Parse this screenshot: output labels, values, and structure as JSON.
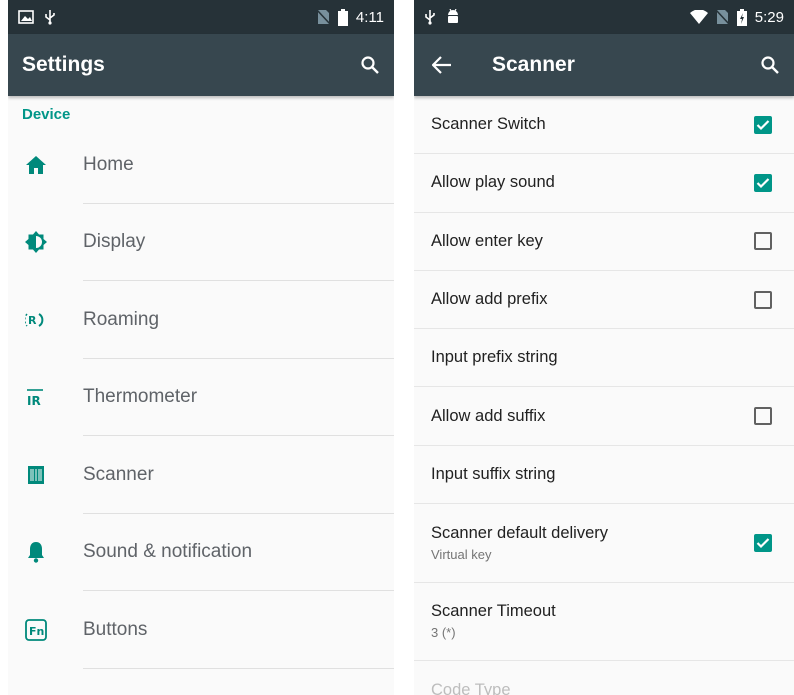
{
  "colors": {
    "accent": "#009688",
    "status_bar": "#263238",
    "toolbar": "#37474f"
  },
  "left_screen": {
    "status": {
      "left_icons": [
        "image-icon",
        "usb-icon"
      ],
      "right_icons": [
        "no-sim-icon",
        "battery-icon"
      ],
      "time": "4:11"
    },
    "toolbar": {
      "title": "Settings",
      "search_icon": "search-icon"
    },
    "section": "Device",
    "items": [
      {
        "label": "Home",
        "icon": "home-icon"
      },
      {
        "label": "Display",
        "icon": "brightness-icon"
      },
      {
        "label": "Roaming",
        "icon": "roaming-icon"
      },
      {
        "label": "Thermometer",
        "icon": "ir-icon",
        "icon_text": "IR"
      },
      {
        "label": "Scanner",
        "icon": "scanner-icon"
      },
      {
        "label": "Sound & notification",
        "icon": "bell-icon"
      },
      {
        "label": "Buttons",
        "icon": "fn-icon",
        "icon_text": "Fn"
      }
    ]
  },
  "right_screen": {
    "status": {
      "left_icons": [
        "usb-icon",
        "android-icon"
      ],
      "right_icons": [
        "wifi-icon",
        "no-sim-icon",
        "battery-charging-icon"
      ],
      "time": "5:29"
    },
    "toolbar": {
      "title": "Scanner",
      "back_icon": "back-arrow-icon",
      "search_icon": "search-icon"
    },
    "items": [
      {
        "title": "Scanner Switch",
        "checkbox": true,
        "checked": true
      },
      {
        "title": "Allow play sound",
        "checkbox": true,
        "checked": true
      },
      {
        "title": "Allow enter key",
        "checkbox": true,
        "checked": false
      },
      {
        "title": "Allow add prefix",
        "checkbox": true,
        "checked": false
      },
      {
        "title": "Input prefix string",
        "checkbox": false
      },
      {
        "title": "Allow add suffix",
        "checkbox": true,
        "checked": false
      },
      {
        "title": "Input suffix string",
        "checkbox": false
      },
      {
        "title": "Scanner default delivery",
        "subtitle": "Virtual key",
        "checkbox": true,
        "checked": true
      },
      {
        "title": "Scanner Timeout",
        "subtitle": "3 (*)",
        "checkbox": false
      },
      {
        "title": "Code Type",
        "checkbox": false,
        "faded": true
      }
    ]
  }
}
